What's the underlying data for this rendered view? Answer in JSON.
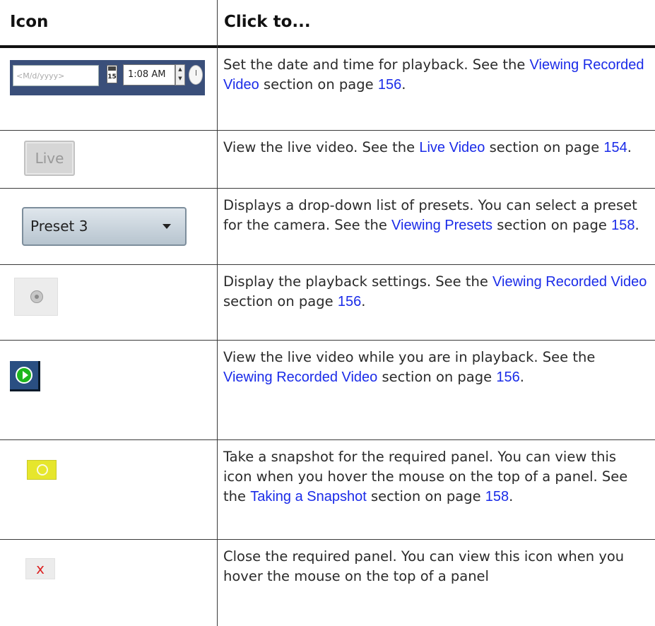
{
  "header": {
    "col_icon": "Icon",
    "col_click": "Click to..."
  },
  "rows": [
    {
      "icon_name": "date-time-control",
      "icon": {
        "date_placeholder": "<M/d/yyyy>",
        "calendar_day": "15",
        "time_value": "1:08 AM",
        "spin": "▲\n▼"
      },
      "desc_before": "Set the date and time for playback. See the ",
      "link": "Viewing Recorded Video",
      "desc_mid": " section on page ",
      "page": "156",
      "desc_after": "."
    },
    {
      "icon_name": "live-button",
      "icon": {
        "label": "Live"
      },
      "desc_before": "View the live video. See the ",
      "link": "Live Video",
      "desc_mid": " section on page ",
      "page": "154",
      "desc_after": "."
    },
    {
      "icon_name": "preset-dropdown",
      "icon": {
        "label": "Preset 3"
      },
      "desc_before": "Displays a drop-down list of presets. You can select a preset for the camera. See the ",
      "link": "Viewing Presets",
      "desc_mid": " section on page ",
      "page": "158",
      "desc_after": "."
    },
    {
      "icon_name": "playback-settings-icon",
      "desc_before": "Display the playback settings. See the ",
      "link": "Viewing Recorded Video",
      "desc_mid": " section on page ",
      "page": "156",
      "desc_after": "."
    },
    {
      "icon_name": "play-icon",
      "desc_before": "View the live video while you are in playback. See the ",
      "link": "Viewing Recorded Video",
      "desc_mid": " section on page ",
      "page": "156",
      "desc_after": "."
    },
    {
      "icon_name": "camera-icon",
      "desc_before": "Take a snapshot for the required panel. You can view this icon when you hover the mouse on the top of a panel. See the ",
      "link": "Taking a Snapshot",
      "desc_mid": " section on page ",
      "page": "158",
      "desc_after": "."
    },
    {
      "icon_name": "close-icon",
      "icon": {
        "glyph": "x"
      },
      "desc_before": "Close the required panel. You can view this icon when you hover the mouse on the top of a panel"
    }
  ],
  "colors": {
    "link": "#1a2be8",
    "rule": "#111111"
  }
}
